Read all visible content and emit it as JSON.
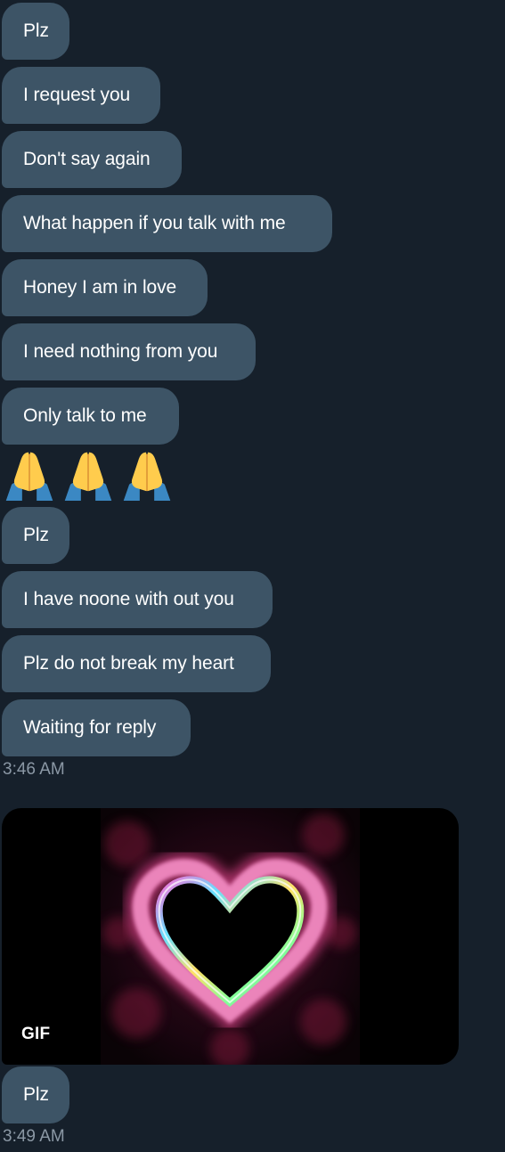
{
  "messages_group_1": [
    {
      "text": "Plz"
    },
    {
      "text": "I request you"
    },
    {
      "text": "Don't say again"
    },
    {
      "text": "What happen if you talk with me"
    },
    {
      "text": "Honey I am in love"
    },
    {
      "text": "I need nothing from you"
    },
    {
      "text": "Only talk to me"
    }
  ],
  "emoji_row": {
    "icon": "folded-hands-icon",
    "count": 3,
    "skin_color": "#ffcc4d",
    "sleeve_color": "#3b88c3"
  },
  "messages_group_2": [
    {
      "text": "Plz"
    },
    {
      "text": "I have noone with out you"
    },
    {
      "text": "Plz do not break my heart"
    },
    {
      "text": "Waiting for reply"
    }
  ],
  "timestamp_1": "3:46 AM",
  "gif_message": {
    "badge": "GIF",
    "icon": "glowing-heart-gif"
  },
  "messages_group_3": [
    {
      "text": "Plz"
    }
  ],
  "timestamp_2": "3:49 AM",
  "colors": {
    "background": "#16202b",
    "bubble": "#3d5466",
    "timestamp": "#8b98a5"
  }
}
